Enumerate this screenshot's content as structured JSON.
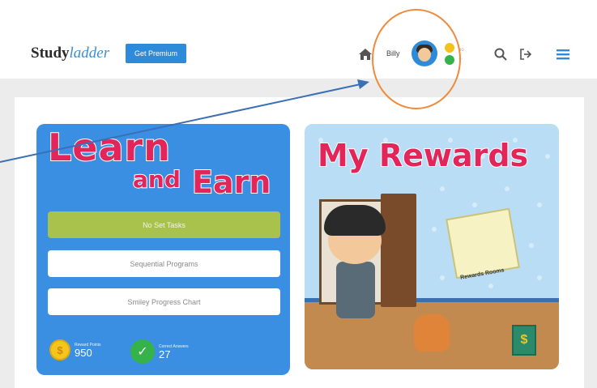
{
  "header": {
    "logo_study": "Study",
    "logo_ladder": "ladder",
    "premium_label": "Get Premium",
    "user_name": "Billy",
    "badge_counts": [
      "oo",
      "..."
    ]
  },
  "icons": {
    "home": "home-icon",
    "search": "search-icon",
    "logout": "logout-icon",
    "menu": "menu-icon"
  },
  "learn_card": {
    "title_line1": "Learn",
    "title_and": "and",
    "title_earn": "Earn",
    "buttons": [
      {
        "label": "No Set Tasks"
      },
      {
        "label": "Sequential Programs"
      },
      {
        "label": "Smiley Progress Chart"
      }
    ],
    "reward_points_label": "Reward Points",
    "reward_points_value": "950",
    "correct_answers_label": "Correct Answers",
    "correct_answers_value": "27"
  },
  "rewards_card": {
    "title": "My Rewards",
    "board_label": "Rewards Rooms"
  },
  "colors": {
    "brand_blue": "#2e8bd9",
    "card_blue": "#3a8fe3",
    "title_red": "#e2265a",
    "green_button": "#a9c24b",
    "annotation_orange": "#f08a3c"
  }
}
